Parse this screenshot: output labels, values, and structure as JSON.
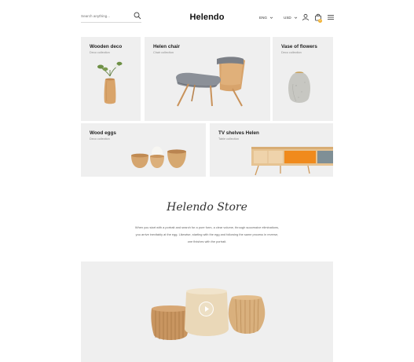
{
  "header": {
    "search_placeholder": "Search anything...",
    "logo": "Helendo",
    "language": "ENG",
    "currency": "USD",
    "cart_count": "0"
  },
  "tiles": [
    {
      "title": "Wooden deco",
      "subtitle": "Deco collection"
    },
    {
      "title": "Helen chair",
      "subtitle": "Chair collection"
    },
    {
      "title": "Vase of flowers",
      "subtitle": "Deco collection"
    },
    {
      "title": "Wood eggs",
      "subtitle": "Deco collection"
    },
    {
      "title": "TV shelves Helen",
      "subtitle": "Table collection"
    }
  ],
  "store": {
    "title": "Helendo Store",
    "lines": [
      "When you start with a portrait and search for a pure form, a clear volume, through successive eliminations,",
      "you arrive inevitably at the egg. Likewise, starting with the egg and following the same process in reverse,",
      "one finishes with the portrait."
    ]
  },
  "colors": {
    "tile_bg": "#efefef",
    "accent": "#f2b233",
    "wood": "#d2a06a",
    "orange": "#f08a1c"
  }
}
